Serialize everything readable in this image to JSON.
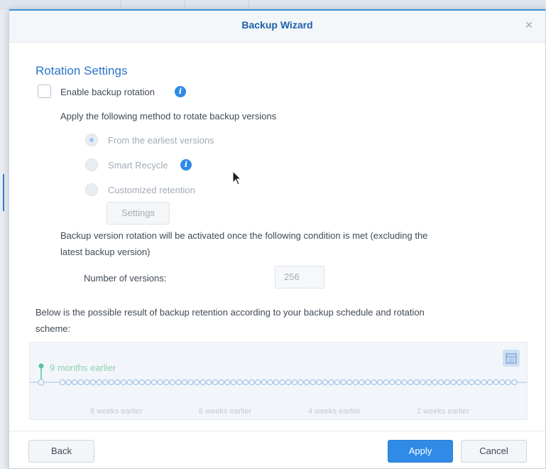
{
  "dialog": {
    "title": "Backup Wizard",
    "close_glyph": "×",
    "section_title": "Rotation Settings"
  },
  "rotation": {
    "enable_label": "Enable backup rotation",
    "enable_checked": false,
    "method_intro": "Apply the following method to rotate backup versions",
    "options": [
      {
        "label": "From the earliest versions",
        "selected": true
      },
      {
        "label": "Smart Recycle",
        "selected": false
      },
      {
        "label": "Customized retention",
        "selected": false
      }
    ],
    "settings_button": "Settings",
    "condition_line1": "Backup version rotation will be activated once the following condition is met (excluding the",
    "condition_line2": "latest backup version)",
    "versions_label": "Number of versions:",
    "versions_value": "256"
  },
  "result": {
    "line1": "Below is the possible result of backup retention according to your backup schedule and rotation",
    "line2": "scheme:",
    "marker_label": "9 months earlier",
    "tick_labels": [
      "8 weeks earlier",
      "6 weeks earlier",
      "4 weeks earlier",
      "2 weeks earlier"
    ]
  },
  "footer": {
    "back": "Back",
    "apply": "Apply",
    "cancel": "Cancel"
  },
  "icons": {
    "info": "info-icon",
    "calendar": "calendar-icon",
    "close": "close-icon",
    "cursor": "mouse-pointer-icon"
  },
  "colors": {
    "accent": "#2f8be6",
    "title": "#1c5fa8",
    "timeline_marker": "#5cc199"
  }
}
